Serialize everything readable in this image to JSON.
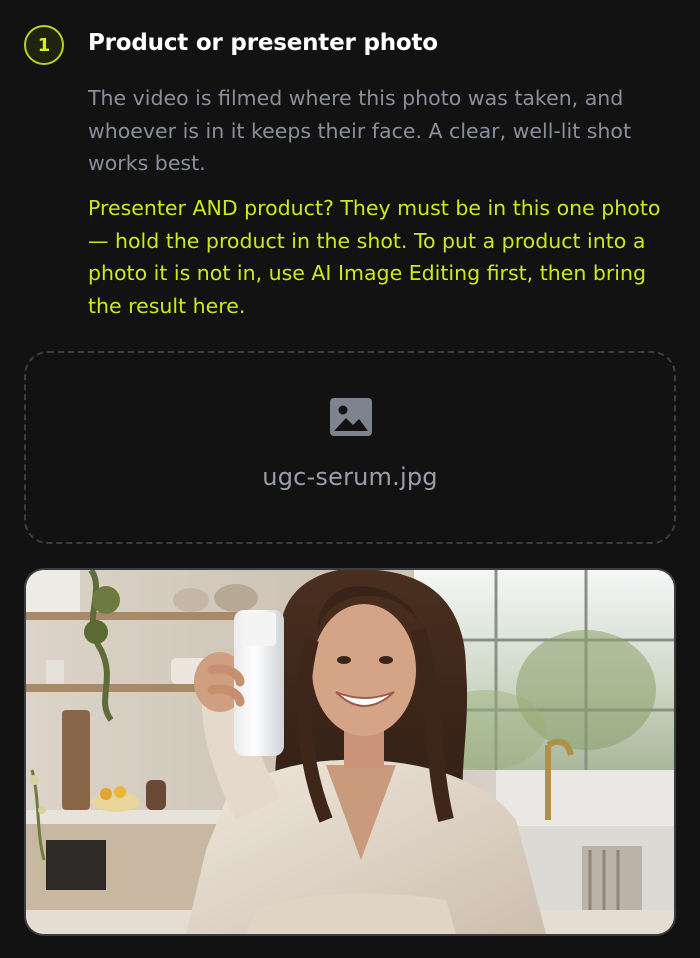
{
  "step": {
    "number": "1",
    "title": "Product or presenter photo",
    "description": "The video is filmed where this photo was taken, and whoever is in it keeps their face. A clear, well-lit shot works best.",
    "notice": "Presenter AND product? They must be in this one photo — hold the product in the shot. To put a product into a photo it is not in, use AI Image Editing first, then bring the result here."
  },
  "upload": {
    "icon": "image-icon",
    "file_name": "ugc-serum.jpg"
  },
  "preview": {
    "alt": "Woman smiling in a sunny kitchen holding up a white serum bottle"
  },
  "colors": {
    "background": "#121212",
    "accent": "#cfe818",
    "muted_text": "#8a8f9e",
    "border": "#3a3d44"
  }
}
